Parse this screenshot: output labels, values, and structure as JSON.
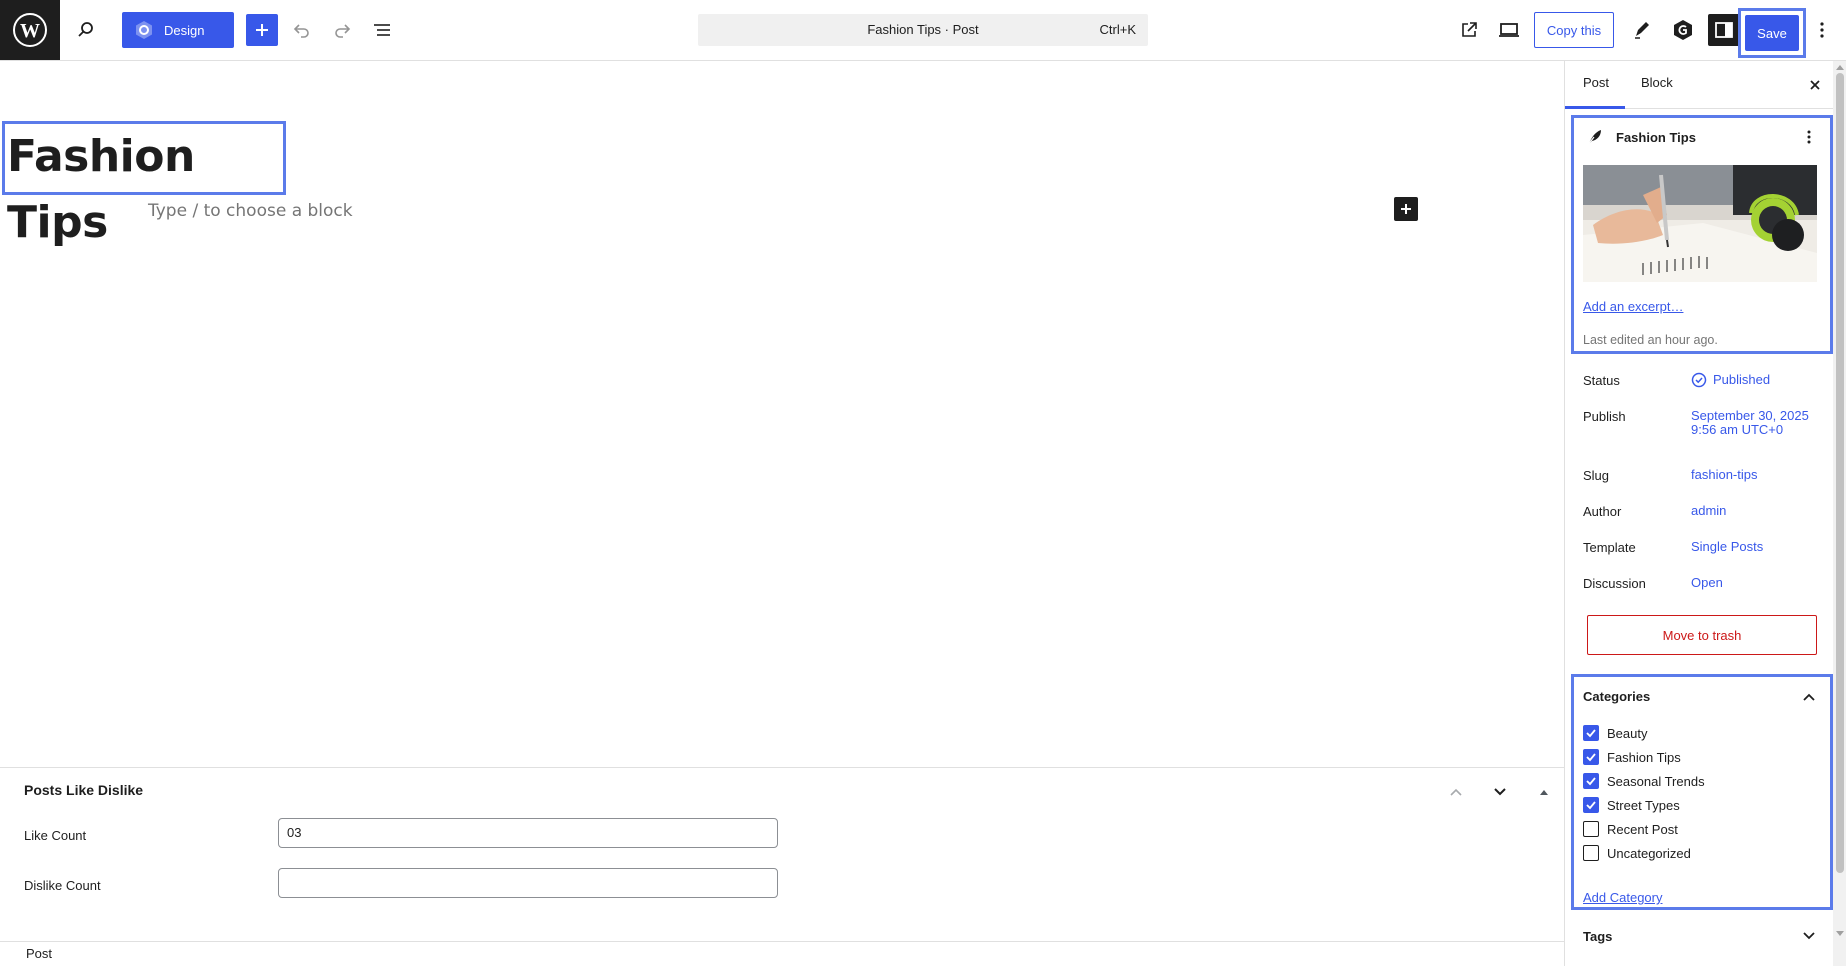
{
  "toolbar": {
    "design_label": "Design",
    "command_title": "Fashion Tips · Post",
    "command_shortcut": "Ctrl+K",
    "copy_label": "Copy this",
    "save_label": "Save"
  },
  "editor": {
    "post_title": "Fashion Tips",
    "block_placeholder": "Type / to choose a block"
  },
  "metabox": {
    "title": "Posts Like Dislike",
    "like_label": "Like Count",
    "like_value": "03",
    "dislike_label": "Dislike Count",
    "dislike_value": ""
  },
  "footer": {
    "breadcrumb": "Post"
  },
  "sidebar": {
    "tabs": [
      {
        "label": "Post"
      },
      {
        "label": "Block"
      }
    ],
    "summary": {
      "title": "Fashion Tips",
      "excerpt_link": "Add an excerpt…",
      "last_edited": "Last edited an hour ago."
    },
    "meta": [
      {
        "key": "Status",
        "value": "Published"
      },
      {
        "key": "Publish",
        "value": "September 30, 2025 9:56 am UTC+0"
      },
      {
        "key": "Slug",
        "value": "fashion-tips"
      },
      {
        "key": "Author",
        "value": "admin"
      },
      {
        "key": "Template",
        "value": "Single Posts"
      },
      {
        "key": "Discussion",
        "value": "Open"
      }
    ],
    "trash_label": "Move to trash",
    "categories": {
      "title": "Categories",
      "items": [
        {
          "label": "Beauty",
          "checked": true
        },
        {
          "label": "Fashion Tips",
          "checked": true
        },
        {
          "label": "Seasonal Trends",
          "checked": true
        },
        {
          "label": "Street Types",
          "checked": true
        },
        {
          "label": "Recent Post",
          "checked": false
        },
        {
          "label": "Uncategorized",
          "checked": false
        }
      ],
      "add_label": "Add Category"
    },
    "tags_title": "Tags"
  },
  "colors": {
    "accent": "#3858e9",
    "danger": "#cc1818",
    "highlight": "#5b7bea"
  }
}
